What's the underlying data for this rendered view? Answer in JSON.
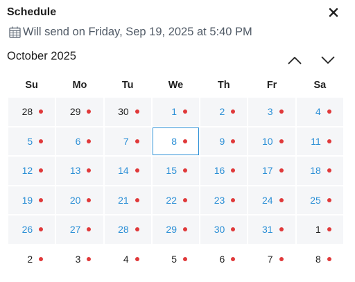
{
  "header": {
    "title": "Schedule",
    "close_icon": "close-icon"
  },
  "send_info": {
    "icon": "calendar-icon",
    "text": "Will send on Friday, Sep 19, 2025 at 5:40 PM"
  },
  "calendar": {
    "month_label": "October 2025",
    "prev_icon": "chevron-up-icon",
    "next_icon": "chevron-down-icon",
    "weekdays": [
      "Su",
      "Mo",
      "Tu",
      "We",
      "Th",
      "Fr",
      "Sa"
    ],
    "selected_day": "8",
    "accent_color": "#2b8fd6",
    "dot_color": "#e0393a",
    "weeks": [
      [
        {
          "label": "28",
          "in_month": false
        },
        {
          "label": "29",
          "in_month": false
        },
        {
          "label": "30",
          "in_month": false
        },
        {
          "label": "1",
          "in_month": true
        },
        {
          "label": "2",
          "in_month": true
        },
        {
          "label": "3",
          "in_month": true
        },
        {
          "label": "4",
          "in_month": true
        }
      ],
      [
        {
          "label": "5",
          "in_month": true
        },
        {
          "label": "6",
          "in_month": true
        },
        {
          "label": "7",
          "in_month": true
        },
        {
          "label": "8",
          "in_month": true,
          "selected": true
        },
        {
          "label": "9",
          "in_month": true
        },
        {
          "label": "10",
          "in_month": true
        },
        {
          "label": "11",
          "in_month": true
        }
      ],
      [
        {
          "label": "12",
          "in_month": true
        },
        {
          "label": "13",
          "in_month": true
        },
        {
          "label": "14",
          "in_month": true
        },
        {
          "label": "15",
          "in_month": true
        },
        {
          "label": "16",
          "in_month": true
        },
        {
          "label": "17",
          "in_month": true
        },
        {
          "label": "18",
          "in_month": true
        }
      ],
      [
        {
          "label": "19",
          "in_month": true
        },
        {
          "label": "20",
          "in_month": true
        },
        {
          "label": "21",
          "in_month": true
        },
        {
          "label": "22",
          "in_month": true
        },
        {
          "label": "23",
          "in_month": true
        },
        {
          "label": "24",
          "in_month": true
        },
        {
          "label": "25",
          "in_month": true
        }
      ],
      [
        {
          "label": "26",
          "in_month": true
        },
        {
          "label": "27",
          "in_month": true
        },
        {
          "label": "28",
          "in_month": true
        },
        {
          "label": "29",
          "in_month": true
        },
        {
          "label": "30",
          "in_month": true
        },
        {
          "label": "31",
          "in_month": true
        },
        {
          "label": "1",
          "in_month": false
        }
      ],
      [
        {
          "label": "2",
          "in_month": false
        },
        {
          "label": "3",
          "in_month": false
        },
        {
          "label": "4",
          "in_month": false
        },
        {
          "label": "5",
          "in_month": false
        },
        {
          "label": "6",
          "in_month": false
        },
        {
          "label": "7",
          "in_month": false
        },
        {
          "label": "8",
          "in_month": false
        }
      ]
    ]
  }
}
